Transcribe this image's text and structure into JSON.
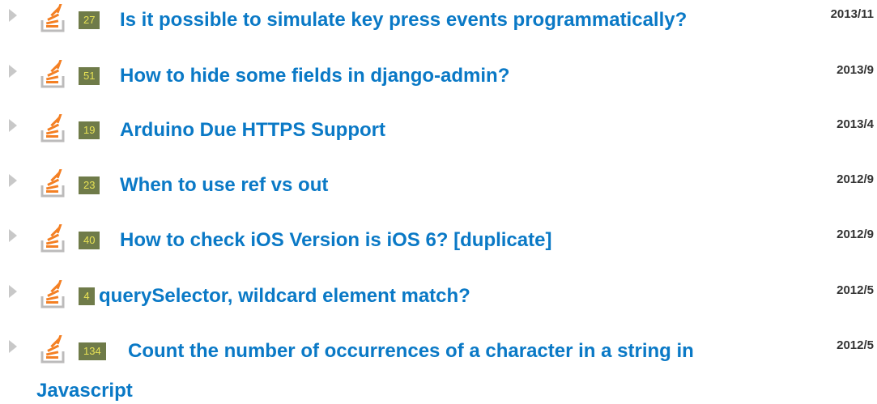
{
  "icon": "stackoverflow-icon",
  "colors": {
    "title": "#0a79c6",
    "score_bg": "#6f7b49",
    "score_text": "#e8e255",
    "date": "#333333",
    "icon_orange": "#f48024",
    "icon_gray": "#bcbbbb",
    "toggle": "#c8c8c8"
  },
  "questions": [
    {
      "score": "27",
      "title": "Is it possible to simulate key press events programmatically?",
      "date": "2013/11"
    },
    {
      "score": "51",
      "title": "How to hide some fields in django-admin?",
      "date": "2013/9"
    },
    {
      "score": "19",
      "title": "Arduino Due HTTPS Support",
      "date": "2013/4"
    },
    {
      "score": "23",
      "title": "When to use ref vs out",
      "date": "2012/9"
    },
    {
      "score": "40",
      "title": "How to check iOS Version is iOS 6? [duplicate]",
      "date": "2012/9"
    },
    {
      "score": "4",
      "title": "querySelector, wildcard element match?",
      "date": "2012/5"
    },
    {
      "score": "134",
      "title": "Count the number of occurrences of a character in a string in",
      "title_cont": "Javascript",
      "date": "2012/5"
    }
  ]
}
